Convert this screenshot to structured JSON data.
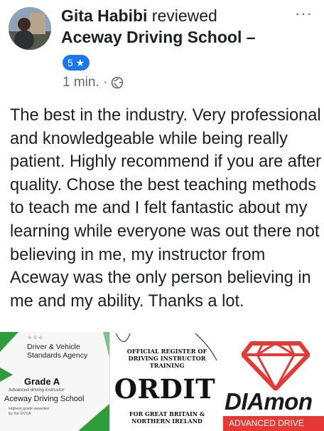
{
  "header": {
    "author": "Gita Habibi",
    "verb": "reviewed",
    "page": "Aceway Driving School –",
    "more_icon": "more-options-icon",
    "rating_badge": "5 ★",
    "time": "1 min. ·",
    "privacy_icon": "globe-icon"
  },
  "review": {
    "text": "The best in the industry. Very professional and knowledgeable while being really patient. Highly recommend if you are after quality. Chose the best teaching methods to teach me and I felt fantastic about my learning while everyone was out there not believing in me, my instructor from Aceway was the only person believing in me and my ability. Thanks a lot."
  },
  "badges": {
    "dvsa": {
      "logo_text": "✧✧✧",
      "org": "Driver & Vehicle Standards Agency",
      "grade": "Grade A",
      "subtitle": "Advanced driving instructor",
      "school": "Aceway Driving School",
      "note": "Highest grade awarded by the DVSA"
    },
    "ordit": {
      "heading": "OFFICIAL REGISTER OF DRIVING INSTRUCTOR TRAINING",
      "name": "ORDIT",
      "footer": "FOR GREAT BRITAIN & NORTHERN IRELAND"
    },
    "diamond": {
      "name": "DIAmon",
      "bar": "ADVANCED DRIVE"
    }
  },
  "colors": {
    "accent": "#1877f2",
    "diamond_red": "#e53935",
    "dvsa_green": "#2e9d3a"
  }
}
